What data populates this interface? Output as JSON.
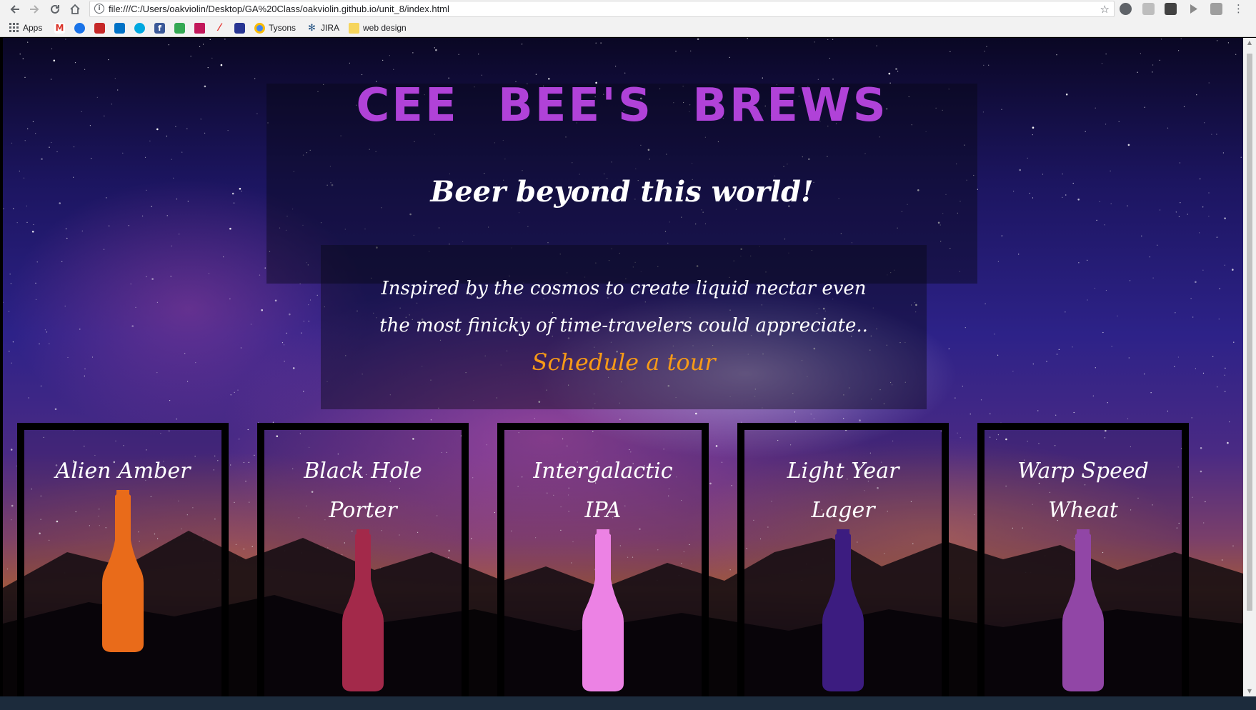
{
  "browser": {
    "url": "file:///C:/Users/oakviolin/Desktop/GA%20Class/oakviolin.github.io/unit_8/index.html",
    "bookmarks": [
      {
        "label": "Apps",
        "icon": "apps-grid-icon",
        "color": "#5f6368"
      },
      {
        "label": "",
        "icon": "gmail-icon",
        "color": "#d93025"
      },
      {
        "label": "",
        "icon": "bookmark-blue-icon",
        "color": "#1a73e8"
      },
      {
        "label": "",
        "icon": "bookmark-red-icon",
        "color": "#c62828"
      },
      {
        "label": "",
        "icon": "outlook-icon",
        "color": "#0072c6"
      },
      {
        "label": "",
        "icon": "att-icon",
        "color": "#00a8e0"
      },
      {
        "label": "",
        "icon": "facebook-icon",
        "color": "#3b5998"
      },
      {
        "label": "",
        "icon": "maps-icon",
        "color": "#34a853"
      },
      {
        "label": "",
        "icon": "bank-icon",
        "color": "#c2185b"
      },
      {
        "label": "",
        "icon": "bookmark-red-slash-icon",
        "color": "#e53935"
      },
      {
        "label": "",
        "icon": "bookmark-navy-icon",
        "color": "#283593"
      },
      {
        "label": "Tysons",
        "icon": "chrome-icon",
        "color": "#4285f4"
      },
      {
        "label": "JIRA",
        "icon": "jira-icon",
        "color": "#205081"
      },
      {
        "label": "web design",
        "icon": "folder-icon",
        "color": "#f6d55c"
      }
    ]
  },
  "page": {
    "title": "CEE BEE'S BREWS",
    "tagline": "Beer beyond this world!",
    "intro_line1": "Inspired by the cosmos to create liquid nectar even",
    "intro_line2": "the most finicky of time-travelers could appreciate..",
    "cta": "Schedule a tour",
    "colors": {
      "title": "#b042d8",
      "cta": "#f79a17",
      "text": "#ffffff"
    }
  },
  "beers": [
    {
      "line1": "Alien Amber",
      "line2": "",
      "color": "#e96b1a"
    },
    {
      "line1": "Black Hole",
      "line2": "Porter",
      "color": "#a3294a"
    },
    {
      "line1": "Intergalactic",
      "line2": "IPA",
      "color": "#ec82e4"
    },
    {
      "line1": "Light Year",
      "line2": "Lager",
      "color": "#3c1c80"
    },
    {
      "line1": "Warp Speed",
      "line2": "Wheat",
      "color": "#9146a6"
    }
  ]
}
